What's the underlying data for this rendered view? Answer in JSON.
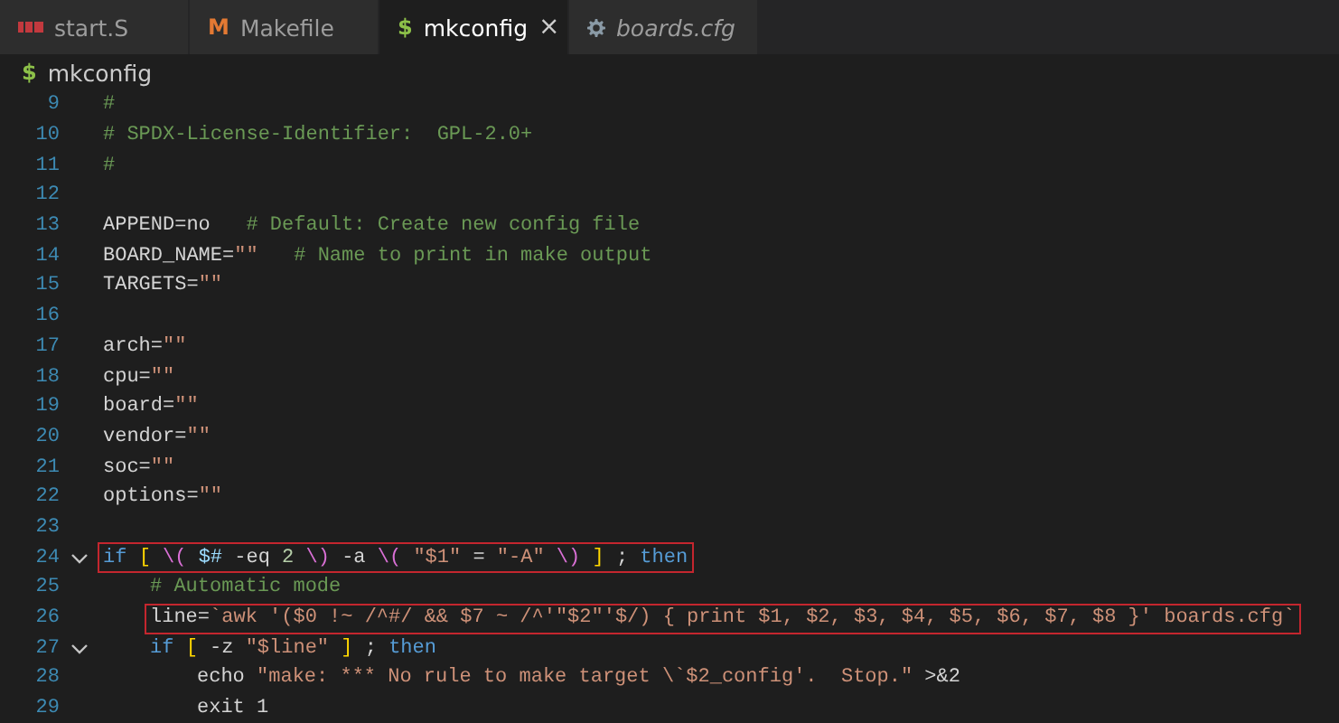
{
  "tabs": [
    {
      "label": "start.S",
      "selected": false,
      "preview": false,
      "icon": {
        "kind": "asm"
      }
    },
    {
      "label": "Makefile",
      "selected": false,
      "preview": false,
      "icon": {
        "kind": "makefile",
        "glyph": "M"
      }
    },
    {
      "label": "mkconfig",
      "selected": true,
      "preview": false,
      "icon": {
        "kind": "shell",
        "glyph": "$"
      },
      "close": "×"
    },
    {
      "label": "boards.cfg",
      "selected": false,
      "preview": true,
      "icon": {
        "kind": "settings"
      }
    }
  ],
  "breadcrumb": {
    "glyph": "$",
    "label": "mkconfig"
  },
  "lines": [
    {
      "number": "9",
      "highlighted": false,
      "tokens": [
        {
          "text": "#",
          "kind": "comment"
        }
      ]
    },
    {
      "number": "10",
      "highlighted": false,
      "tokens": [
        {
          "text": "# SPDX-License-Identifier:  GPL-2.0+",
          "kind": "comment"
        }
      ]
    },
    {
      "number": "11",
      "highlighted": false,
      "tokens": [
        {
          "text": "#",
          "kind": "comment"
        }
      ]
    },
    {
      "number": "12"
    },
    {
      "number": "13",
      "highlighted": false,
      "tokens": [
        {
          "text": "APPEND=no   ",
          "kind": "plain"
        },
        {
          "text": "# Default: Create new config file",
          "kind": "comment"
        }
      ]
    },
    {
      "number": "14",
      "highlighted": false,
      "tokens": [
        {
          "text": "BOARD_NAME=",
          "kind": "plain"
        },
        {
          "text": "\"\"",
          "kind": "string"
        },
        {
          "text": "   # Name to print in make output",
          "kind": "comment"
        }
      ]
    },
    {
      "number": "15",
      "highlighted": false,
      "tokens": [
        {
          "text": "TARGETS=",
          "kind": "plain"
        },
        {
          "text": "\"\"",
          "kind": "string"
        }
      ]
    },
    {
      "number": "16"
    },
    {
      "number": "17",
      "highlighted": false,
      "tokens": [
        {
          "text": "arch=",
          "kind": "plain"
        },
        {
          "text": "\"\"",
          "kind": "string"
        }
      ]
    },
    {
      "number": "18",
      "highlighted": false,
      "tokens": [
        {
          "text": "cpu=",
          "kind": "plain"
        },
        {
          "text": "\"\"",
          "kind": "string"
        }
      ]
    },
    {
      "number": "19",
      "highlighted": false,
      "tokens": [
        {
          "text": "board=",
          "kind": "plain"
        },
        {
          "text": "\"\"",
          "kind": "string"
        }
      ]
    },
    {
      "number": "20",
      "highlighted": false,
      "tokens": [
        {
          "text": "vendor=",
          "kind": "plain"
        },
        {
          "text": "\"\"",
          "kind": "string"
        }
      ]
    },
    {
      "number": "21",
      "highlighted": false,
      "tokens": [
        {
          "text": "soc=",
          "kind": "plain"
        },
        {
          "text": "\"\"",
          "kind": "string"
        }
      ]
    },
    {
      "number": "22",
      "highlighted": false,
      "tokens": [
        {
          "text": "options=",
          "kind": "plain"
        },
        {
          "text": "\"\"",
          "kind": "string"
        }
      ]
    },
    {
      "number": "23"
    },
    {
      "number": "24",
      "highlighted": true,
      "expanded": true,
      "tokens": [
        {
          "text": "if ",
          "kind": "keyword"
        },
        {
          "text": "[ ",
          "kind": "bracket"
        },
        {
          "text": "\\( ",
          "kind": "paren"
        },
        {
          "text": "$# ",
          "kind": "variable"
        },
        {
          "text": "-eq ",
          "kind": "plain"
        },
        {
          "text": "2 ",
          "kind": "number"
        },
        {
          "text": "\\) ",
          "kind": "paren"
        },
        {
          "text": "-a ",
          "kind": "plain"
        },
        {
          "text": "\\( ",
          "kind": "paren"
        },
        {
          "text": "\"$1\"",
          "kind": "string"
        },
        {
          "text": " = ",
          "kind": "plain"
        },
        {
          "text": "\"-A\" ",
          "kind": "string"
        },
        {
          "text": "\\) ",
          "kind": "paren"
        },
        {
          "text": "]",
          "kind": "bracket"
        },
        {
          "text": " ; ",
          "kind": "plain"
        },
        {
          "text": "then",
          "kind": "keyword"
        }
      ],
      "children": [
        {
          "number": "25",
          "highlighted": false,
          "tokens": [
            {
              "text": "# Automatic mode",
              "kind": "comment"
            }
          ]
        },
        {
          "number": "26",
          "highlighted": true,
          "tokens": [
            {
              "text": "line=",
              "kind": "plain"
            },
            {
              "text": "`awk '($0 !~ /^#/ && $7 ~ /^'\"$2\"'$/) { print $1, $2, $3, $4, $5, $6, $7, $8 }' boards.cfg`",
              "kind": "string"
            }
          ]
        },
        {
          "number": "27",
          "highlighted": false,
          "expanded": true,
          "tokens": [
            {
              "text": "if ",
              "kind": "keyword"
            },
            {
              "text": "[",
              "kind": "bracket"
            },
            {
              "text": " -z ",
              "kind": "plain"
            },
            {
              "text": "\"$line\" ",
              "kind": "string"
            },
            {
              "text": "]",
              "kind": "bracket"
            },
            {
              "text": " ; ",
              "kind": "plain"
            },
            {
              "text": "then",
              "kind": "keyword"
            }
          ],
          "children": [
            {
              "number": "28",
              "highlighted": false,
              "tokens": [
                {
                  "text": "echo ",
                  "kind": "plain"
                },
                {
                  "text": "\"make: *** No rule to make target \\`$2_config'.  Stop.\"",
                  "kind": "string"
                },
                {
                  "text": " >&2",
                  "kind": "plain"
                }
              ]
            },
            {
              "number": "29",
              "highlighted": false,
              "tokens": [
                {
                  "text": "exit 1",
                  "kind": "plain"
                }
              ]
            }
          ]
        }
      ]
    }
  ]
}
